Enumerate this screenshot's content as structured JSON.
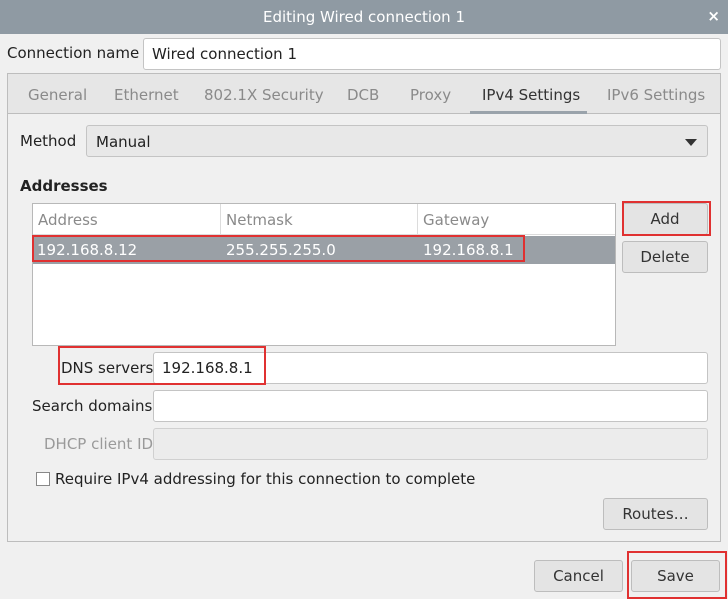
{
  "window": {
    "title": "Editing Wired connection 1",
    "close_glyph": "×"
  },
  "connection": {
    "label": "Connection name",
    "value": "Wired connection 1"
  },
  "tabs": [
    {
      "label": "General"
    },
    {
      "label": "Ethernet"
    },
    {
      "label": "802.1X Security"
    },
    {
      "label": "DCB"
    },
    {
      "label": "Proxy"
    },
    {
      "label": "IPv4 Settings",
      "active": true
    },
    {
      "label": "IPv6 Settings"
    }
  ],
  "method": {
    "label": "Method",
    "value": "Manual"
  },
  "addresses": {
    "heading": "Addresses",
    "columns": [
      "Address",
      "Netmask",
      "Gateway"
    ],
    "rows": [
      {
        "address": "192.168.8.12",
        "netmask": "255.255.255.0",
        "gateway": "192.168.8.1"
      }
    ],
    "add_label": "Add",
    "delete_label": "Delete"
  },
  "dns": {
    "label": "DNS servers",
    "value": "192.168.8.1"
  },
  "search": {
    "label": "Search domains",
    "value": ""
  },
  "dhcp": {
    "label": "DHCP client ID",
    "value": ""
  },
  "require": {
    "label": "Require IPv4 addressing for this connection to complete",
    "checked": false
  },
  "routes_label": "Routes…",
  "footer": {
    "cancel_label": "Cancel",
    "save_label": "Save"
  },
  "highlight_color": "#e03131"
}
